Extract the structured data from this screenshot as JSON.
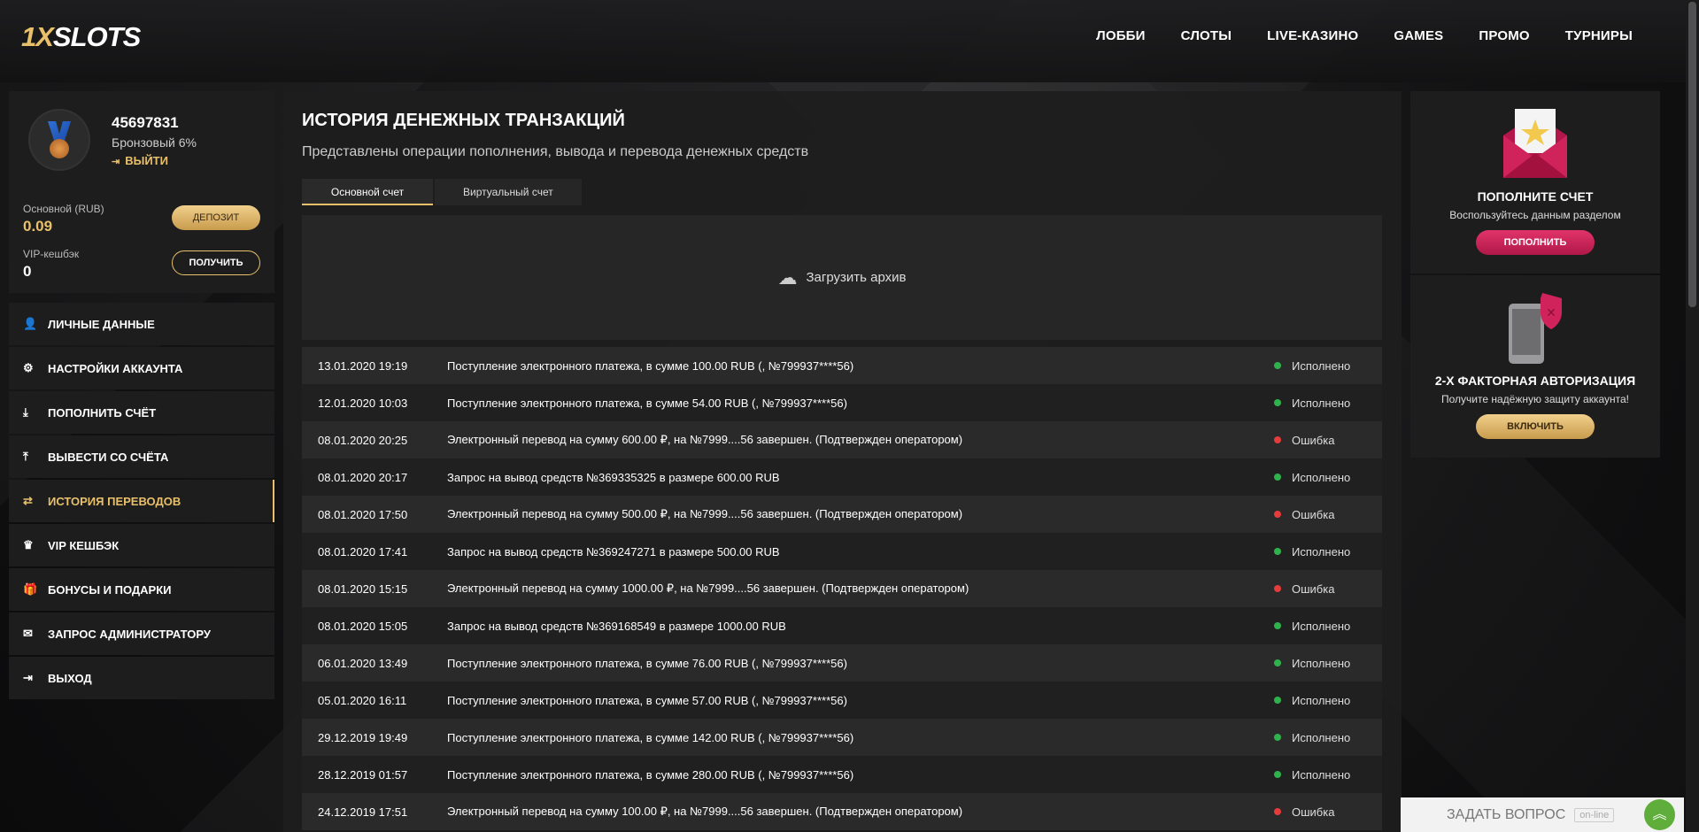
{
  "header": {
    "logo_prefix": "1X",
    "logo_text": "SLOTS",
    "nav": [
      "ЛОББИ",
      "СЛОТЫ",
      "LIVE-КАЗИНО",
      "GAMES",
      "ПРОМО",
      "ТУРНИРЫ"
    ]
  },
  "profile": {
    "user_id": "45697831",
    "level": "Бронзовый 6%",
    "logout": "ВЫЙТИ",
    "main_account_label": "Основной (RUB)",
    "main_balance": "0.09",
    "vip_label": "VIP-кешбэк",
    "vip_value": "0",
    "deposit_button": "ДЕПОЗИТ",
    "get_button": "ПОЛУЧИТЬ"
  },
  "menu": [
    {
      "label": "ЛИЧНЫЕ ДАННЫЕ",
      "icon": "user-plus-icon",
      "glyph": "👤"
    },
    {
      "label": "НАСТРОЙКИ АККАУНТА",
      "icon": "gears-icon",
      "glyph": "⚙"
    },
    {
      "label": "ПОПОЛНИТЬ СЧЁТ",
      "icon": "download-icon",
      "glyph": "⤓"
    },
    {
      "label": "ВЫВЕСТИ СО СЧЁТА",
      "icon": "upload-icon",
      "glyph": "⤒"
    },
    {
      "label": "ИСТОРИЯ ПЕРЕВОДОВ",
      "icon": "transfer-icon",
      "glyph": "⇄",
      "active": true
    },
    {
      "label": "VIP КЕШБЭК",
      "icon": "crown-icon",
      "glyph": "♛"
    },
    {
      "label": "БОНУСЫ И ПОДАРКИ",
      "icon": "gift-icon",
      "glyph": "🎁"
    },
    {
      "label": "ЗАПРОС АДМИНИСТРАТОРУ",
      "icon": "envelope-icon",
      "glyph": "✉"
    },
    {
      "label": "ВЫХОД",
      "icon": "logout-icon",
      "glyph": "⇥"
    }
  ],
  "main": {
    "title": "ИСТОРИЯ ДЕНЕЖНЫХ ТРАНЗАКЦИЙ",
    "subtitle": "Представлены операции пополнения, вывода и перевода денежных средств",
    "tabs": [
      "Основной счет",
      "Виртуальный счет"
    ],
    "archive_label": "Загрузить архив",
    "transactions": [
      {
        "date": "13.01.2020 19:19",
        "desc": "Поступление электронного платежа, в сумме 100.00 RUB (, №799937****56)",
        "status": "Исполнено",
        "ok": true
      },
      {
        "date": "12.01.2020 10:03",
        "desc": "Поступление электронного платежа, в сумме 54.00 RUB (, №799937****56)",
        "status": "Исполнено",
        "ok": true
      },
      {
        "date": "08.01.2020 20:25",
        "desc": "Электронный перевод на сумму 600.00 ₽, на №7999....56 завершен. (Подтвержден оператором)",
        "status": "Ошибка",
        "ok": false
      },
      {
        "date": "08.01.2020 20:17",
        "desc": "Запрос на вывод средств №369335325 в размере 600.00 RUB",
        "status": "Исполнено",
        "ok": true
      },
      {
        "date": "08.01.2020 17:50",
        "desc": "Электронный перевод на сумму 500.00 ₽, на №7999....56 завершен. (Подтвержден оператором)",
        "status": "Ошибка",
        "ok": false
      },
      {
        "date": "08.01.2020 17:41",
        "desc": "Запрос на вывод средств №369247271 в размере 500.00 RUB",
        "status": "Исполнено",
        "ok": true
      },
      {
        "date": "08.01.2020 15:15",
        "desc": "Электронный перевод на сумму 1000.00 ₽, на №7999....56 завершен. (Подтвержден оператором)",
        "status": "Ошибка",
        "ok": false
      },
      {
        "date": "08.01.2020 15:05",
        "desc": "Запрос на вывод средств №369168549 в размере 1000.00 RUB",
        "status": "Исполнено",
        "ok": true
      },
      {
        "date": "06.01.2020 13:49",
        "desc": "Поступление электронного платежа, в сумме 76.00 RUB (, №799937****56)",
        "status": "Исполнено",
        "ok": true
      },
      {
        "date": "05.01.2020 16:11",
        "desc": "Поступление электронного платежа, в сумме 57.00 RUB (, №799937****56)",
        "status": "Исполнено",
        "ok": true
      },
      {
        "date": "29.12.2019 19:49",
        "desc": "Поступление электронного платежа, в сумме 142.00 RUB (, №799937****56)",
        "status": "Исполнено",
        "ok": true
      },
      {
        "date": "28.12.2019 01:57",
        "desc": "Поступление электронного платежа, в сумме 280.00 RUB (, №799937****56)",
        "status": "Исполнено",
        "ok": true
      },
      {
        "date": "24.12.2019 17:51",
        "desc": "Электронный перевод на сумму 100.00 ₽, на №7999....56 завершен. (Подтвержден оператором)",
        "status": "Ошибка",
        "ok": false
      }
    ]
  },
  "widgets": {
    "deposit": {
      "title": "ПОПОЛНИТЕ СЧЕТ",
      "subtitle": "Воспользуйтесь данным разделом",
      "button": "ПОПОЛНИТЬ"
    },
    "twofa": {
      "title": "2-Х ФАКТОРНАЯ АВТОРИЗАЦИЯ",
      "subtitle": "Получите надёжную защиту аккаунта!",
      "button": "ВКЛЮЧИТЬ"
    }
  },
  "chat": {
    "label": "ЗАДАТЬ ВОПРОС",
    "status": "on-line"
  },
  "colors": {
    "accent": "#e9c06a",
    "success": "#2fb24c",
    "error": "#e43b3b",
    "pink": "#d32760"
  }
}
